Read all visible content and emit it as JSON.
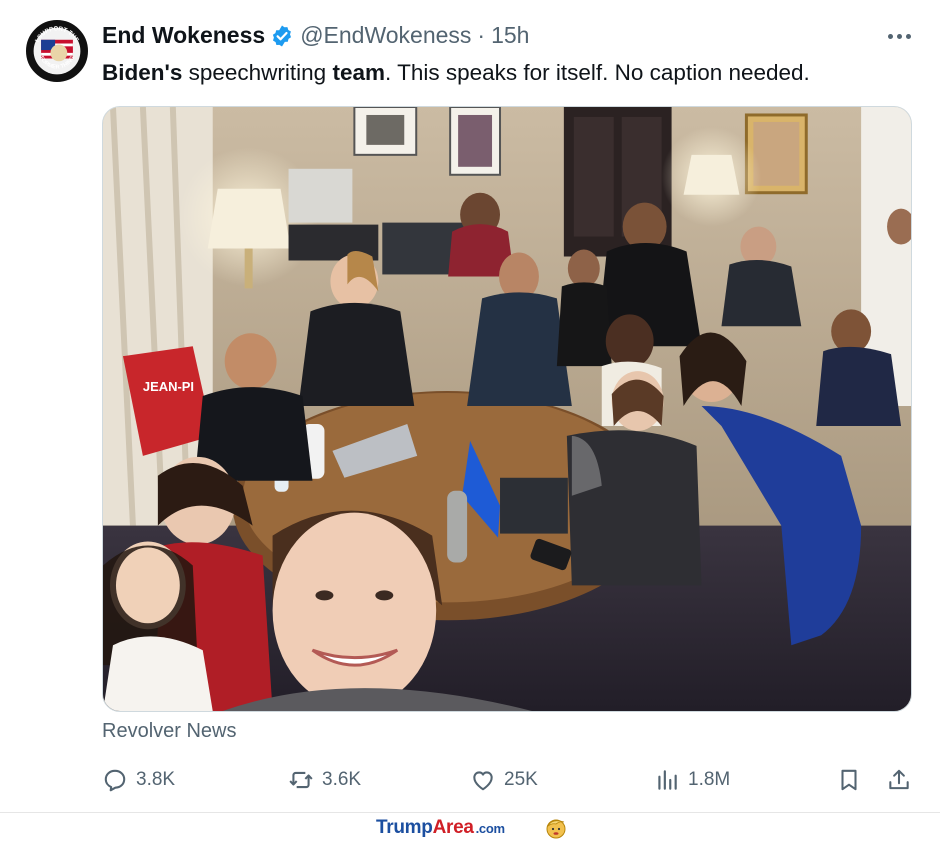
{
  "tweet": {
    "author_name": "End Wokeness",
    "handle": "@EndWokeness",
    "separator": "·",
    "time": "15h",
    "text_parts": [
      {
        "text": "Biden's",
        "bold": true
      },
      {
        "text": " speechwriting ",
        "bold": false
      },
      {
        "text": "team",
        "bold": true
      },
      {
        "text": ". This speaks for itself. No caption needed.",
        "bold": false
      }
    ],
    "source": "Revolver News",
    "icons": {
      "avatar": "avatar-badge-icon",
      "verified": "verified-badge-icon",
      "more": "more-options-icon"
    },
    "avatar_badge_text": [
      "I SUPPORT THE",
      "FORMER THING"
    ],
    "photo_shirt_text": "JEAN-PI",
    "accent_color": "#1d9bf0"
  },
  "actions": {
    "reply": {
      "count": "3.8K",
      "icon": "reply-icon"
    },
    "repost": {
      "count": "3.6K",
      "icon": "repost-icon"
    },
    "like": {
      "count": "25K",
      "icon": "heart-icon"
    },
    "views": {
      "count": "1.8M",
      "icon": "views-icon"
    },
    "bookmark": {
      "icon": "bookmark-icon"
    },
    "share": {
      "icon": "share-icon"
    }
  },
  "footer": {
    "brand_part1": "Trump",
    "brand_part2": "Area",
    "brand_part3": ".com",
    "brand_icon": "trump-face-icon"
  }
}
